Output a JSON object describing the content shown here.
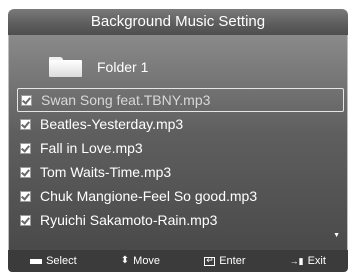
{
  "window": {
    "title": "Background Music Setting"
  },
  "folder": {
    "label": "Folder 1",
    "icon": "folder-icon"
  },
  "tracks": [
    {
      "name": "Swan Song feat.TBNY.mp3",
      "checked": true,
      "selected": true
    },
    {
      "name": "Beatles-Yesterday.mp3",
      "checked": true,
      "selected": false
    },
    {
      "name": "Fall in Love.mp3",
      "checked": true,
      "selected": false
    },
    {
      "name": "Tom Waits-Time.mp3",
      "checked": true,
      "selected": false
    },
    {
      "name": "Chuk Mangione-Feel So good.mp3",
      "checked": true,
      "selected": false
    },
    {
      "name": "Ryuichi Sakamoto-Rain.mp3",
      "checked": true,
      "selected": false
    }
  ],
  "scroll": {
    "icon": "scroll-down-arrow-icon"
  },
  "footer": {
    "select": "Select",
    "move": "Move",
    "enter": "Enter",
    "exit": "Exit"
  },
  "colors": {
    "title_bar": "#5e5e5e",
    "panel_top": "#8a8a8a",
    "panel_bottom": "#4a4a4a",
    "footer": "#3b3b3b",
    "selection_border": "#e6e6e6"
  }
}
